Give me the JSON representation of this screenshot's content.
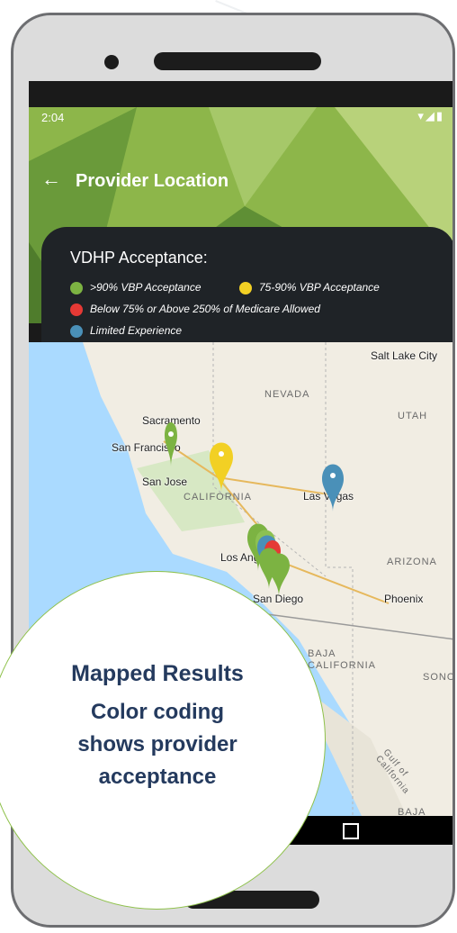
{
  "status_bar": {
    "time": "2:04",
    "icons": "▾◢▮"
  },
  "toolbar": {
    "back_icon": "←",
    "title": "Provider Location"
  },
  "legend": {
    "title": "VDHP Acceptance:",
    "items": [
      {
        "label": ">90% VBP Acceptance",
        "color": "#7cb342"
      },
      {
        "label": "75-90% VBP Acceptance",
        "color": "#f2d024"
      },
      {
        "label": "Below 75% or Above 250% of Medicare Allowed",
        "color": "#e53935"
      },
      {
        "label": "Limited Experience",
        "color": "#4a90b8"
      }
    ]
  },
  "map": {
    "labels": {
      "salt_lake_city": "Salt Lake City",
      "nevada": "NEVADA",
      "utah": "UTAH",
      "sacramento": "Sacramento",
      "san_francisco": "San Francisco",
      "san_jose": "San Jose",
      "california": "CALIFORNIA",
      "las_vegas": "Las Vegas",
      "los_angeles": "Los Angeles",
      "arizona": "ARIZONA",
      "san_diego": "San Diego",
      "phoenix": "Phoenix",
      "baja_california": "BAJA\nCALIFORNIA",
      "sonora": "SONO",
      "gulf": "Gulf of California",
      "baja": "BAJA"
    }
  },
  "callout": {
    "heading": "Mapped Results",
    "lines": [
      "Color coding",
      "shows provider",
      "acceptance"
    ]
  },
  "colors": {
    "brand_navy": "#243a5e",
    "header_green": "#8db64a",
    "accent_green": "#8ec14a"
  }
}
